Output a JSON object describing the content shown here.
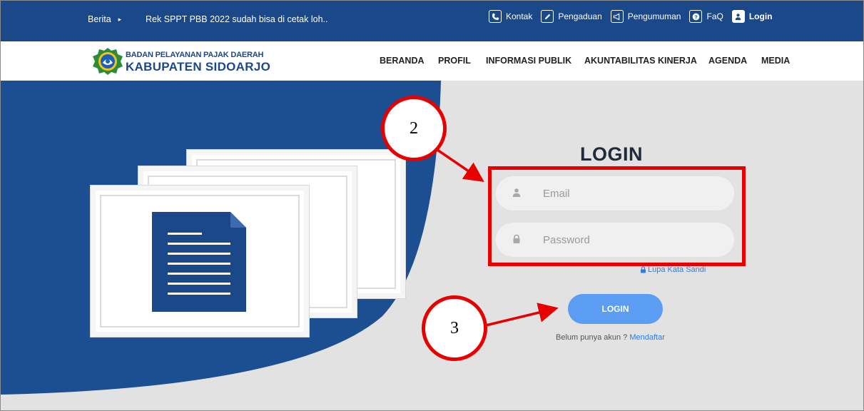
{
  "topbar": {
    "news_label": "Berita",
    "ticker_text": "Rek SPPT PBB 2022 sudah bisa di cetak loh..",
    "links": {
      "kontak": "Kontak",
      "pengaduan": "Pengaduan",
      "pengumuman": "Pengumuman",
      "faq": "FaQ",
      "login": "Login"
    }
  },
  "brand": {
    "line1": "BADAN PELAYANAN PAJAK DAERAH",
    "line2": "KABUPATEN SIDOARJO"
  },
  "menu": {
    "beranda": "BERANDA",
    "profil": "PROFIL",
    "informasi_publik": "INFORMASI PUBLIK",
    "akuntabilitas_kinerja": "AKUNTABILITAS KINERJA",
    "agenda": "AGENDA",
    "media": "MEDIA"
  },
  "login_form": {
    "title": "LOGIN",
    "email_placeholder": "Email",
    "password_placeholder": "Password",
    "forgot_label": "Lupa Kata Sandi",
    "button_label": "LOGIN",
    "register_prompt": "Belum punya akun ?",
    "register_link": "Mendaftar"
  },
  "annotations": {
    "step_2": "2",
    "step_3": "3",
    "highlight_color": "#e60000"
  },
  "colors": {
    "brand_blue": "#1b4888",
    "button_blue": "#5a9df2",
    "link_blue": "#2f7de1",
    "background_gray": "#e2e2e2"
  }
}
